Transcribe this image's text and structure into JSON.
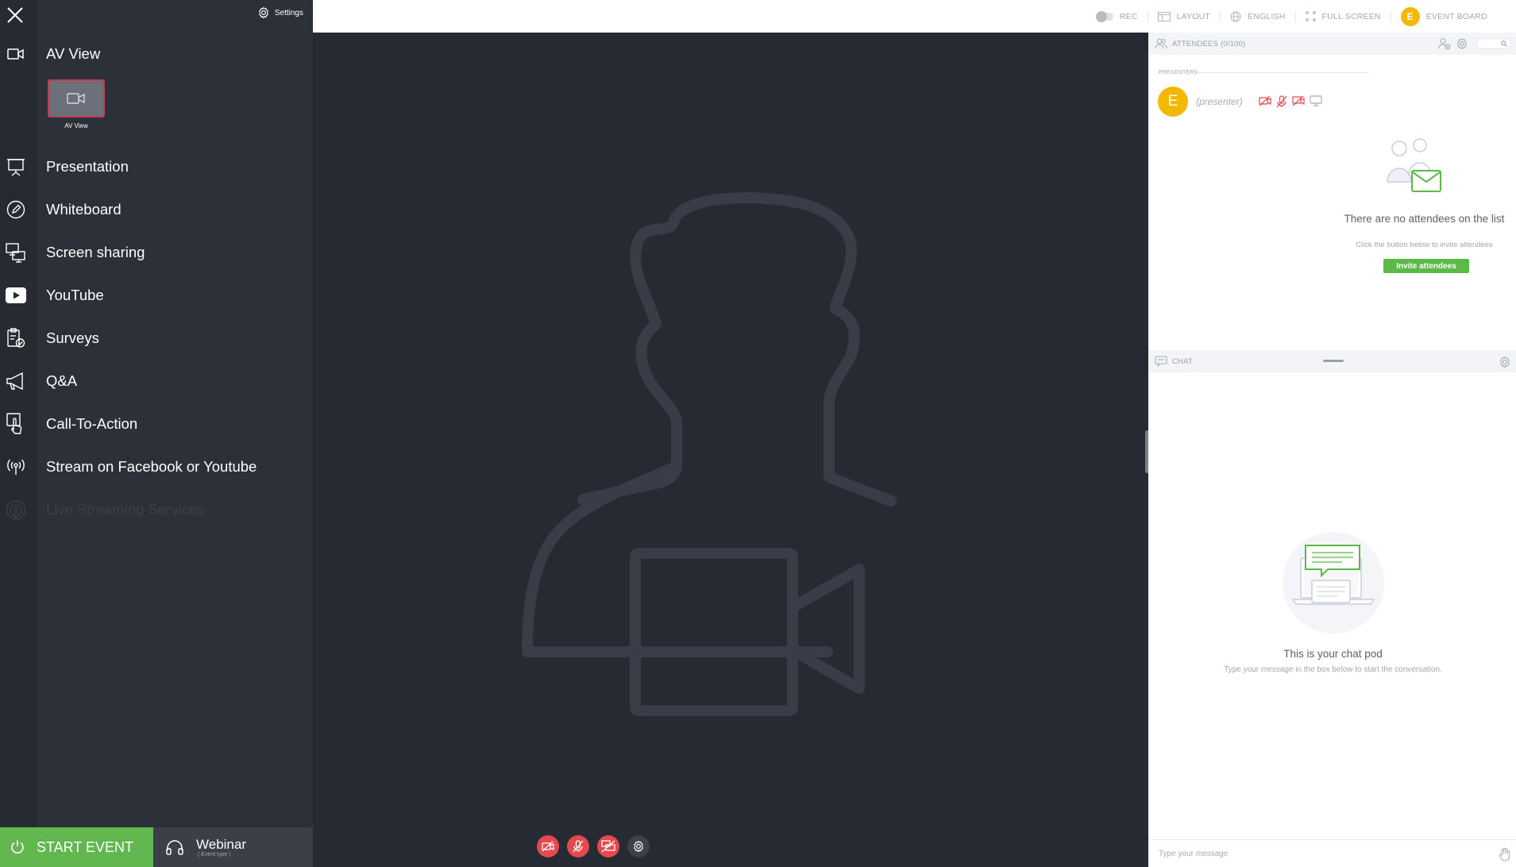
{
  "topbar": {
    "rec_label": "REC",
    "layout_label": "LAYOUT",
    "language_label": "ENGLISH",
    "fullscreen_label": "FULL SCREEN",
    "event_board_initial": "E",
    "event_board_label": "EVENT BOARD"
  },
  "sidebar": {
    "settings_label": "Settings",
    "items": [
      {
        "label": "AV View",
        "icon": "video-camera-icon"
      },
      {
        "label": "Presentation",
        "icon": "presentation-board-icon"
      },
      {
        "label": "Whiteboard",
        "icon": "pencil-circle-icon"
      },
      {
        "label": "Screen sharing",
        "icon": "screen-share-icon"
      },
      {
        "label": "YouTube",
        "icon": "youtube-icon"
      },
      {
        "label": "Surveys",
        "icon": "clipboard-check-icon"
      },
      {
        "label": "Q&A",
        "icon": "megaphone-icon"
      },
      {
        "label": "Call-To-Action",
        "icon": "touch-hand-icon"
      },
      {
        "label": "Stream on Facebook or Youtube",
        "icon": "broadcast-icon"
      },
      {
        "label": "Live Streaming Services",
        "icon": "antenna-icon",
        "disabled": true
      }
    ],
    "av_thumb_label": "AV View",
    "start_event_label": "START EVENT",
    "event_type_name": "Webinar",
    "event_type_sub": "( Event type )"
  },
  "attendees": {
    "title": "ATTENDEES (0/100)",
    "presenters_label": "PRESENTERS",
    "presenter_initial": "E",
    "presenter_role": "(presenter)",
    "empty_title": "There are no attendees on the list",
    "empty_sub": "Click the button below to invite attendees",
    "invite_label": "Invite attendees"
  },
  "chat": {
    "title": "CHAT",
    "empty_title": "This is your chat pod",
    "empty_sub": "Type your message in the box below to start the conversation.",
    "input_placeholder": "Type your message"
  },
  "colors": {
    "accent_green": "#62b84f",
    "presenter_yellow": "#f5b800",
    "mute_red": "#e5484d",
    "sidebar_bg": "#2c3038",
    "stage_bg": "#262a33"
  }
}
